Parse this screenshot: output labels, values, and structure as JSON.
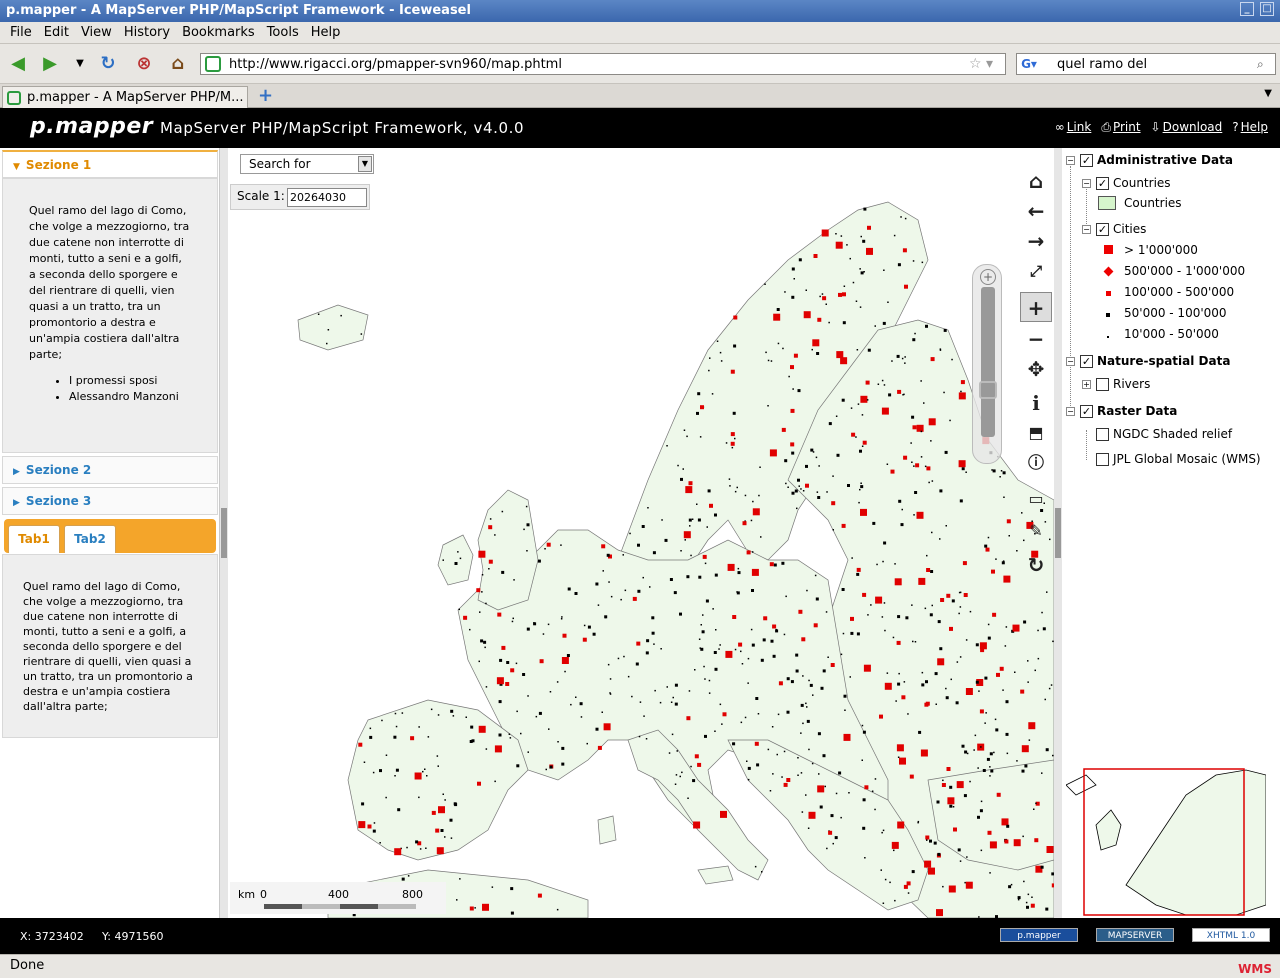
{
  "window": {
    "title": "p.mapper - A MapServer PHP/MapScript Framework - Iceweasel"
  },
  "menu": [
    "File",
    "Edit",
    "View",
    "History",
    "Bookmarks",
    "Tools",
    "Help"
  ],
  "nav": {
    "url": "http://www.rigacci.org/pmapper-svn960/map.phtml",
    "search_text": "quel ramo del"
  },
  "tabs": [
    {
      "label": "p.mapper - A MapServer PHP/M..."
    }
  ],
  "app": {
    "logo": "p.mapper",
    "title": "MapServer  PHP/MapScript  Framework, v4.0.0",
    "links": {
      "link": "Link",
      "print": "Print",
      "download": "Download",
      "help": "Help"
    }
  },
  "left": {
    "sections": [
      {
        "title": "Sezione 1",
        "expanded": true
      },
      {
        "title": "Sezione 2",
        "expanded": false
      },
      {
        "title": "Sezione 3",
        "expanded": false
      }
    ],
    "section1_text": "Quel ramo del lago di Como, che volge a mezzogiorno, tra due catene non interrotte di monti, tutto a seni e a golfi, a seconda dello sporgere e del rientrare di quelli, vien quasi a un tratto, tra un promontorio a destra e un'ampia costiera dall'altra parte;",
    "section1_list": [
      "I promessi sposi",
      "Alessandro Manzoni"
    ],
    "tabs": [
      "Tab1",
      "Tab2"
    ],
    "tab_text": "Quel ramo del lago di Como, che volge a mezzogiorno, tra due catene non interrotte di monti, tutto a seni e a golfi, a seconda dello sporgere e del rientrare di quelli, vien quasi a un tratto, tra un promontorio a destra e un'ampia costiera dall'altra parte;"
  },
  "map": {
    "search_label": "Search for",
    "scale_label": "Scale 1:",
    "scale_value": "20264030",
    "scalebar_unit": "km",
    "scalebar_ticks": [
      "0",
      "400",
      "800"
    ],
    "colors": {
      "land": "#eef8ea",
      "cities": "#e00000",
      "small_cities": "#000000",
      "border": "#666666"
    }
  },
  "tools": [
    "home-icon",
    "back-icon",
    "forward-icon",
    "zoom-select-icon",
    "zoom-in-icon",
    "zoom-out-icon",
    "pan-icon",
    "identify-icon",
    "select-icon",
    "auto-identify-icon",
    "measure-icon",
    "poi-icon",
    "refresh-icon"
  ],
  "toc": {
    "groups": [
      {
        "name": "Administrative Data",
        "checked": true,
        "layers": [
          {
            "name": "Countries",
            "checked": true,
            "classes": [
              "Countries"
            ]
          },
          {
            "name": "Cities",
            "checked": true,
            "classes": [
              "> 1'000'000",
              "500'000 - 1'000'000",
              "100'000 - 500'000",
              "50'000 - 100'000",
              "10'000 - 50'000"
            ]
          }
        ]
      },
      {
        "name": "Nature-spatial Data",
        "checked": true,
        "layers": [
          {
            "name": "Rivers",
            "checked": false
          }
        ]
      },
      {
        "name": "Raster Data",
        "checked": true,
        "layers": [
          {
            "name": "NGDC Shaded relief",
            "checked": false
          },
          {
            "name": "JPL Global Mosaic (WMS)",
            "checked": false
          }
        ]
      }
    ]
  },
  "footer": {
    "x_label": "X:",
    "x_value": "3723402",
    "y_label": "Y:",
    "y_value": "4971560",
    "badges": [
      "p.mapper",
      "MAPSERVER",
      "XHTML 1.0"
    ]
  },
  "status": {
    "text": "Done",
    "indicator": "WMS"
  }
}
